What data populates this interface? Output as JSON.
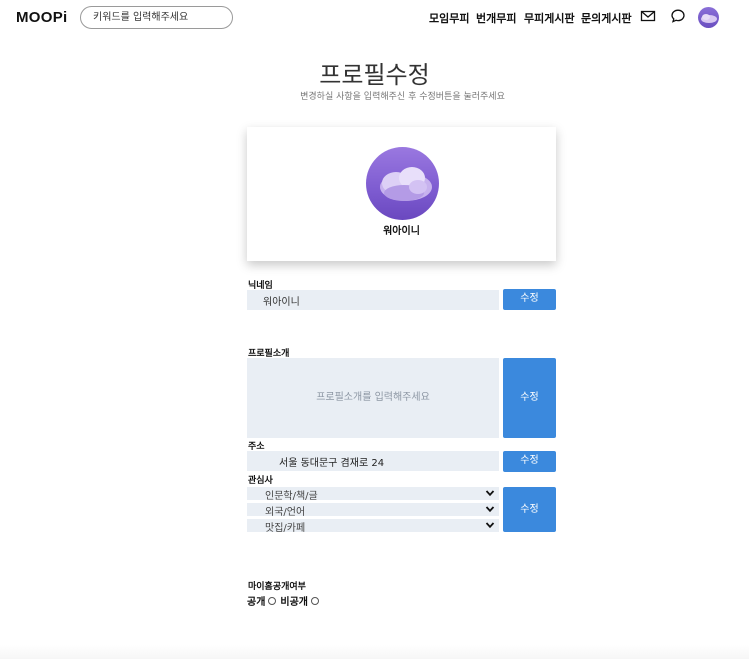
{
  "header": {
    "logo": "MOOPi",
    "search_placeholder": "키워드를 입력해주세요",
    "nav": [
      "모임무피",
      "번개무피",
      "무피게시판",
      "문의게시판"
    ],
    "icons": [
      "mail-icon",
      "chat-bubble-icon",
      "user-avatar"
    ]
  },
  "page": {
    "title": "프로필수정",
    "subtitle": "변경하실 사항을 입력해주신 후 수정버튼을 눌러주세요"
  },
  "profile": {
    "name": "워아이니"
  },
  "form": {
    "nickname_label": "닉네임",
    "nickname_value": "워아이니",
    "intro_label": "프로필소개",
    "intro_placeholder": "프로필소개를 입력해주세요",
    "address_label": "주소",
    "address_value": "서울 동대문구 겸재로 24",
    "interest_label": "관심사",
    "interests": [
      "인문학/책/글",
      "외국/언어",
      "맛집/카페"
    ],
    "edit_button": "수정",
    "visibility_label": "마이홈공개여부",
    "visibility_options": [
      "공개",
      "비공개"
    ]
  },
  "colors": {
    "accent": "#3b89dd",
    "field_bg": "#e9eef4"
  }
}
